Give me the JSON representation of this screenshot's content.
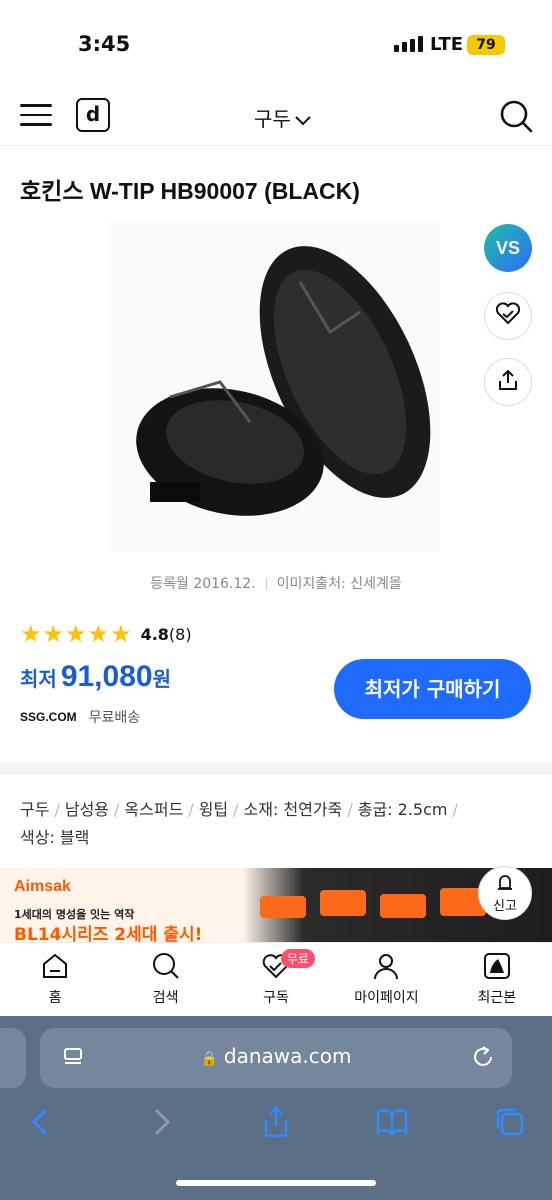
{
  "status": {
    "time": "3:45",
    "network": "LTE",
    "battery": "79"
  },
  "header": {
    "logo": "d",
    "category": "구두"
  },
  "product": {
    "title": "호킨스 W-TIP HB90007 (BLACK)",
    "registered": "등록월 2016.12.",
    "image_source": "이미지출처: 신세계몰",
    "rating": "4.8",
    "review_count": "(8)",
    "stars": "★★★★★",
    "price_label": "최저",
    "price": "91,080",
    "price_unit": "원",
    "shop": "SSG.COM",
    "shipping": "무료배송",
    "buy_button": "최저가 구매하기",
    "specs": [
      "구두",
      "남성용",
      "옥스퍼드",
      "윙팁",
      "소재: 천연가죽",
      "총굽: 2.5cm",
      "색상: 블랙"
    ]
  },
  "side": {
    "vs": "VS"
  },
  "banner": {
    "brand": "Aimsak",
    "line1": "1세대의 명성을 잇는 역작",
    "line2": "BL14시리즈 2세대 출시!"
  },
  "report": {
    "label": "신고"
  },
  "tabs": [
    {
      "label": "홈",
      "icon": "home-icon"
    },
    {
      "label": "검색",
      "icon": "search-icon"
    },
    {
      "label": "구독",
      "icon": "heart-check-icon",
      "badge": "무료"
    },
    {
      "label": "마이페이지",
      "icon": "user-icon"
    },
    {
      "label": "최근본",
      "icon": "recent-icon"
    }
  ],
  "browser": {
    "url": "danawa.com"
  },
  "colors": {
    "accent": "#1f6bff",
    "price": "#1a5bd8",
    "star": "#ffc107",
    "badge": "#ff4d6d"
  }
}
